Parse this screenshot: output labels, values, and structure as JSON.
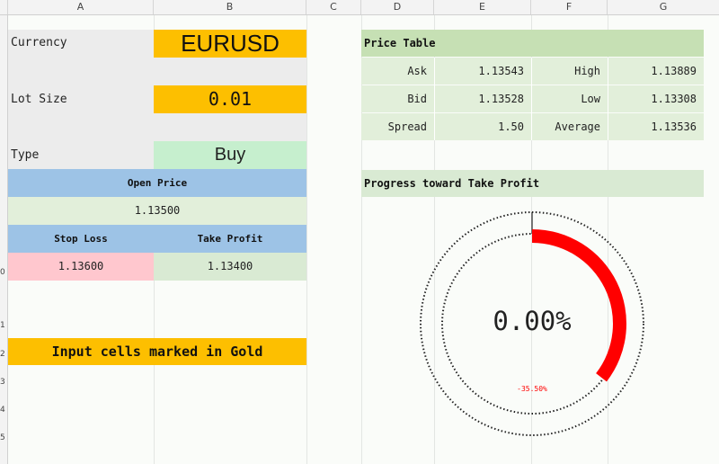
{
  "columns": [
    "A",
    "B",
    "C",
    "D",
    "E",
    "F",
    "G"
  ],
  "row_numbers": [
    "0",
    "1",
    "2",
    "3",
    "4",
    "5"
  ],
  "currency": {
    "label": "Currency",
    "value": "EURUSD"
  },
  "lot_size": {
    "label": "Lot Size",
    "value": "0.01"
  },
  "type": {
    "label": "Type",
    "value": "Buy"
  },
  "open_price": {
    "header": "Open Price",
    "value": "1.13500"
  },
  "stop_loss": {
    "header": "Stop Loss",
    "value": "1.13600"
  },
  "take_profit": {
    "header": "Take Profit",
    "value": "1.13400"
  },
  "note": "Input cells marked in Gold",
  "price_table": {
    "title": "Price Table",
    "rows": [
      {
        "label": "Ask",
        "value": "1.13543",
        "label2": "High",
        "value2": "1.13889"
      },
      {
        "label": "Bid",
        "value": "1.13528",
        "label2": "Low",
        "value2": "1.13308"
      },
      {
        "label": "Spread",
        "value": "1.50",
        "label2": "Average",
        "value2": "1.13536"
      }
    ]
  },
  "progress": {
    "title": "Progress toward Take Profit",
    "percent_label": "0.00%",
    "sub_label": "-35.50%",
    "arc_fraction": 0.355,
    "arc_color": "#ff0000"
  },
  "colors": {
    "gold": "#fdbf00",
    "blue_header": "#9dc3e6",
    "green_light": "#e2efda",
    "red_light": "#ffc7ce"
  }
}
